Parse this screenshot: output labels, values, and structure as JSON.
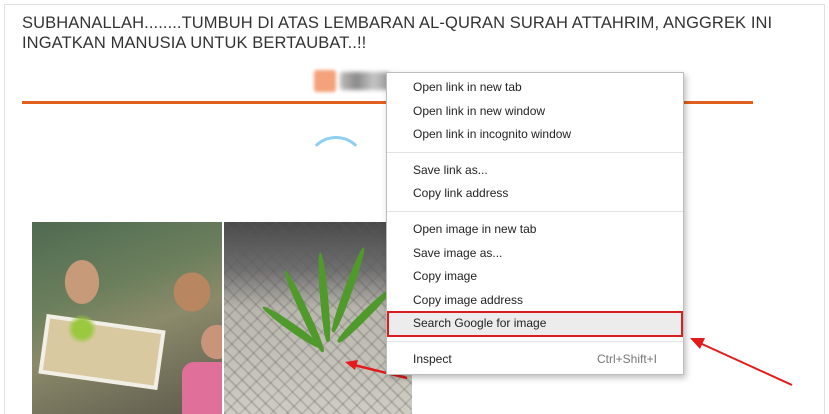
{
  "article": {
    "headline": "SUBHANALLAH........TUMBUH DI ATAS LEMBARAN AL-QURAN SURAH ATTAHRIM, ANGGREK INI INGATKAN MANUSIA UNTUK BERTAUBAT..!!"
  },
  "context_menu": {
    "groups": [
      {
        "items": [
          {
            "label": "Open link in new tab"
          },
          {
            "label": "Open link in new window"
          },
          {
            "label": "Open link in incognito window"
          }
        ]
      },
      {
        "items": [
          {
            "label": "Save link as..."
          },
          {
            "label": "Copy link address"
          }
        ]
      },
      {
        "items": [
          {
            "label": "Open image in new tab"
          },
          {
            "label": "Save image as..."
          },
          {
            "label": "Copy image"
          },
          {
            "label": "Copy image address"
          },
          {
            "label": "Search Google for image"
          }
        ]
      },
      {
        "items": [
          {
            "label": "Inspect",
            "shortcut": "Ctrl+Shift+I"
          }
        ]
      }
    ],
    "highlighted_item": "Search Google for image"
  },
  "colors": {
    "accent_rule": "#e0601e",
    "highlight_outline": "#d81e1e",
    "arrow": "#e31b1b"
  },
  "icons": {
    "spinner": "loading-spinner-icon",
    "logo": "site-logo"
  }
}
